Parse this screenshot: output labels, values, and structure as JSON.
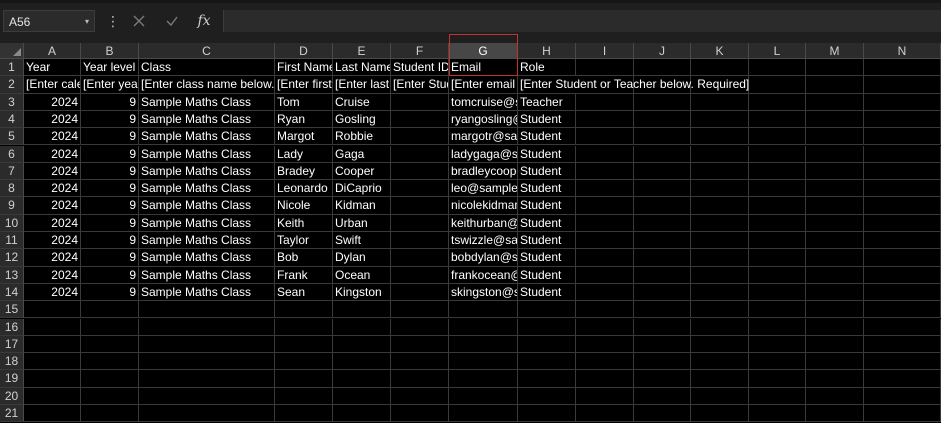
{
  "formula_bar": {
    "name_box": "A56",
    "caret": "▾",
    "separator": "⋮",
    "cancel_icon": "✕",
    "enter_icon": "✓",
    "fx_label": "fx",
    "formula_value": ""
  },
  "columns": [
    "A",
    "B",
    "C",
    "D",
    "E",
    "F",
    "G",
    "H",
    "I",
    "J",
    "K",
    "L",
    "M",
    "N"
  ],
  "selected_column": "G",
  "rows": [
    "1",
    "2",
    "3",
    "4",
    "5",
    "6",
    "7",
    "8",
    "9",
    "10",
    "11",
    "12",
    "13",
    "14",
    "15",
    "16",
    "17",
    "18",
    "19",
    "20",
    "21"
  ],
  "header_row": [
    "Year",
    "Year level",
    "Class",
    "First Name",
    "Last Name",
    "Student ID",
    "Email",
    "Role"
  ],
  "instruction_row": [
    "[Enter calendar year below]",
    "[Enter year level below]",
    "[Enter class name below. Required]",
    "[Enter first name below]",
    "[Enter last name below]",
    "[Enter Student ID below]",
    "[Enter email below]",
    "[Enter Student or Teacher below. Required]"
  ],
  "data_rows": [
    {
      "year": "2024",
      "level": "9",
      "class": "Sample Maths Class",
      "first": "Tom",
      "last": "Cruise",
      "id": "",
      "email": "tomcruise@sample.com",
      "role": "Teacher"
    },
    {
      "year": "2024",
      "level": "9",
      "class": "Sample Maths Class",
      "first": "Ryan",
      "last": "Gosling",
      "id": "",
      "email": "ryangosling@sample.com",
      "role": "Student"
    },
    {
      "year": "2024",
      "level": "9",
      "class": "Sample Maths Class",
      "first": "Margot",
      "last": "Robbie",
      "id": "",
      "email": "margotr@sample.com",
      "role": "Student"
    },
    {
      "year": "2024",
      "level": "9",
      "class": "Sample Maths Class",
      "first": "Lady",
      "last": "Gaga",
      "id": "",
      "email": "ladygaga@sample.com",
      "role": "Student"
    },
    {
      "year": "2024",
      "level": "9",
      "class": "Sample Maths Class",
      "first": "Bradey",
      "last": "Cooper",
      "id": "",
      "email": "bradleycooper@sample.com",
      "role": "Student"
    },
    {
      "year": "2024",
      "level": "9",
      "class": "Sample Maths Class",
      "first": "Leonardo",
      "last": "DiCaprio",
      "id": "",
      "email": "leo@sample.com",
      "role": "Student"
    },
    {
      "year": "2024",
      "level": "9",
      "class": "Sample Maths Class",
      "first": "Nicole",
      "last": "Kidman",
      "id": "",
      "email": "nicolekidman@sample.com",
      "role": "Student"
    },
    {
      "year": "2024",
      "level": "9",
      "class": "Sample Maths Class",
      "first": "Keith",
      "last": "Urban",
      "id": "",
      "email": "keithurban@sample.com",
      "role": "Student"
    },
    {
      "year": "2024",
      "level": "9",
      "class": "Sample Maths Class",
      "first": "Taylor",
      "last": "Swift",
      "id": "",
      "email": "tswizzle@sample.com",
      "role": "Student"
    },
    {
      "year": "2024",
      "level": "9",
      "class": "Sample Maths Class",
      "first": "Bob",
      "last": "Dylan",
      "id": "",
      "email": "bobdylan@sample.com",
      "role": "Student"
    },
    {
      "year": "2024",
      "level": "9",
      "class": "Sample Maths Class",
      "first": "Frank",
      "last": "Ocean",
      "id": "",
      "email": "frankocean@sample.com",
      "role": "Student"
    },
    {
      "year": "2024",
      "level": "9",
      "class": "Sample Maths Class",
      "first": "Sean",
      "last": "Kingston",
      "id": "",
      "email": "skingston@sample.com",
      "role": "Student"
    }
  ],
  "colors": {
    "background": "#000000",
    "header_bg": "#2b2b2b",
    "selected_header_bg": "#474747",
    "gridline": "#3a3a3a",
    "selection_outline": "#c0342f",
    "text": "#ffffff"
  }
}
